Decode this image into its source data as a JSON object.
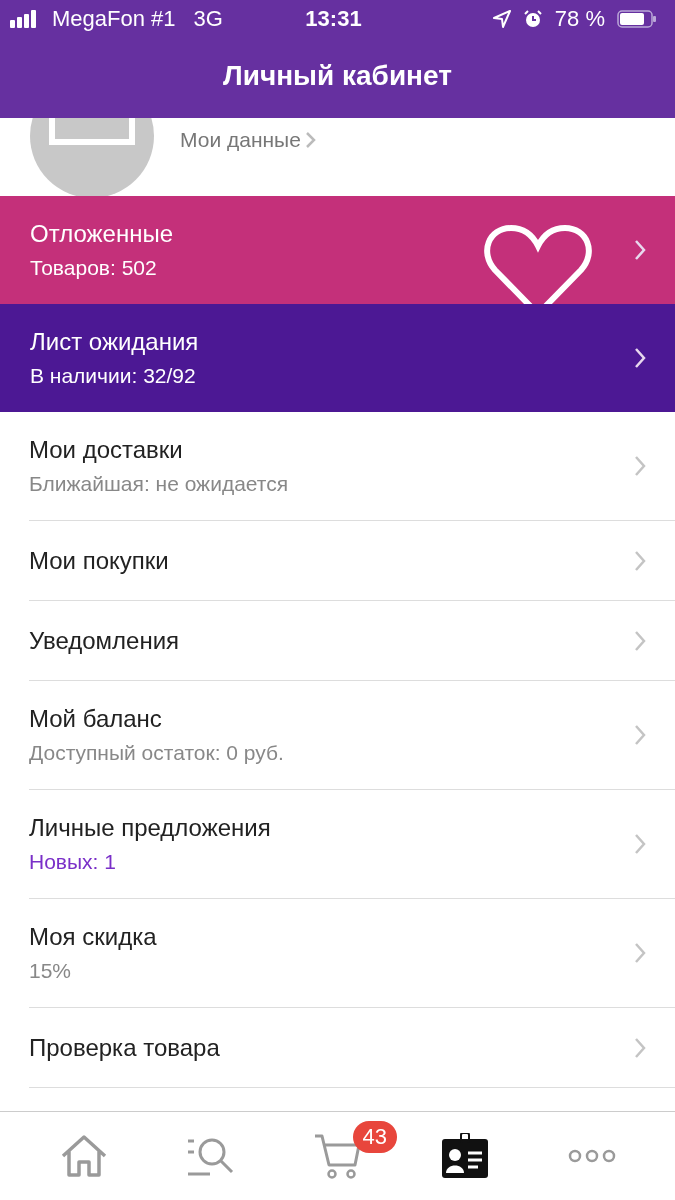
{
  "status_bar": {
    "carrier": "MegaFon #1",
    "network": "3G",
    "time": "13:31",
    "battery": "78 %"
  },
  "header": {
    "title": "Личный кабинет"
  },
  "profile": {
    "link": "Мои данные"
  },
  "cards": [
    {
      "title": "Отложенные",
      "subtitle": "Товаров: 502",
      "kind": "favorites",
      "color": "#c4307a"
    },
    {
      "title": "Лист ожидания",
      "subtitle": "В наличии: 32/92",
      "kind": "waitlist",
      "color": "#4c1894"
    }
  ],
  "menu": [
    {
      "title": "Мои доставки",
      "subtitle": "Ближайшая: не ожидается",
      "highlight": false
    },
    {
      "title": "Мои покупки"
    },
    {
      "title": "Уведомления"
    },
    {
      "title": "Мой баланс",
      "subtitle": "Доступный остаток: 0 руб.",
      "highlight": false
    },
    {
      "title": "Личные предложения",
      "subtitle": "Новых: 1",
      "highlight": true
    },
    {
      "title": "Моя скидка",
      "subtitle": "15%",
      "highlight": false
    },
    {
      "title": "Проверка товара"
    }
  ],
  "tab_bar": [
    {
      "kind": "home",
      "selected": false
    },
    {
      "kind": "search",
      "selected": false
    },
    {
      "kind": "cart",
      "selected": false,
      "badge": "43"
    },
    {
      "kind": "profile",
      "selected": true
    },
    {
      "kind": "more",
      "selected": false
    }
  ]
}
